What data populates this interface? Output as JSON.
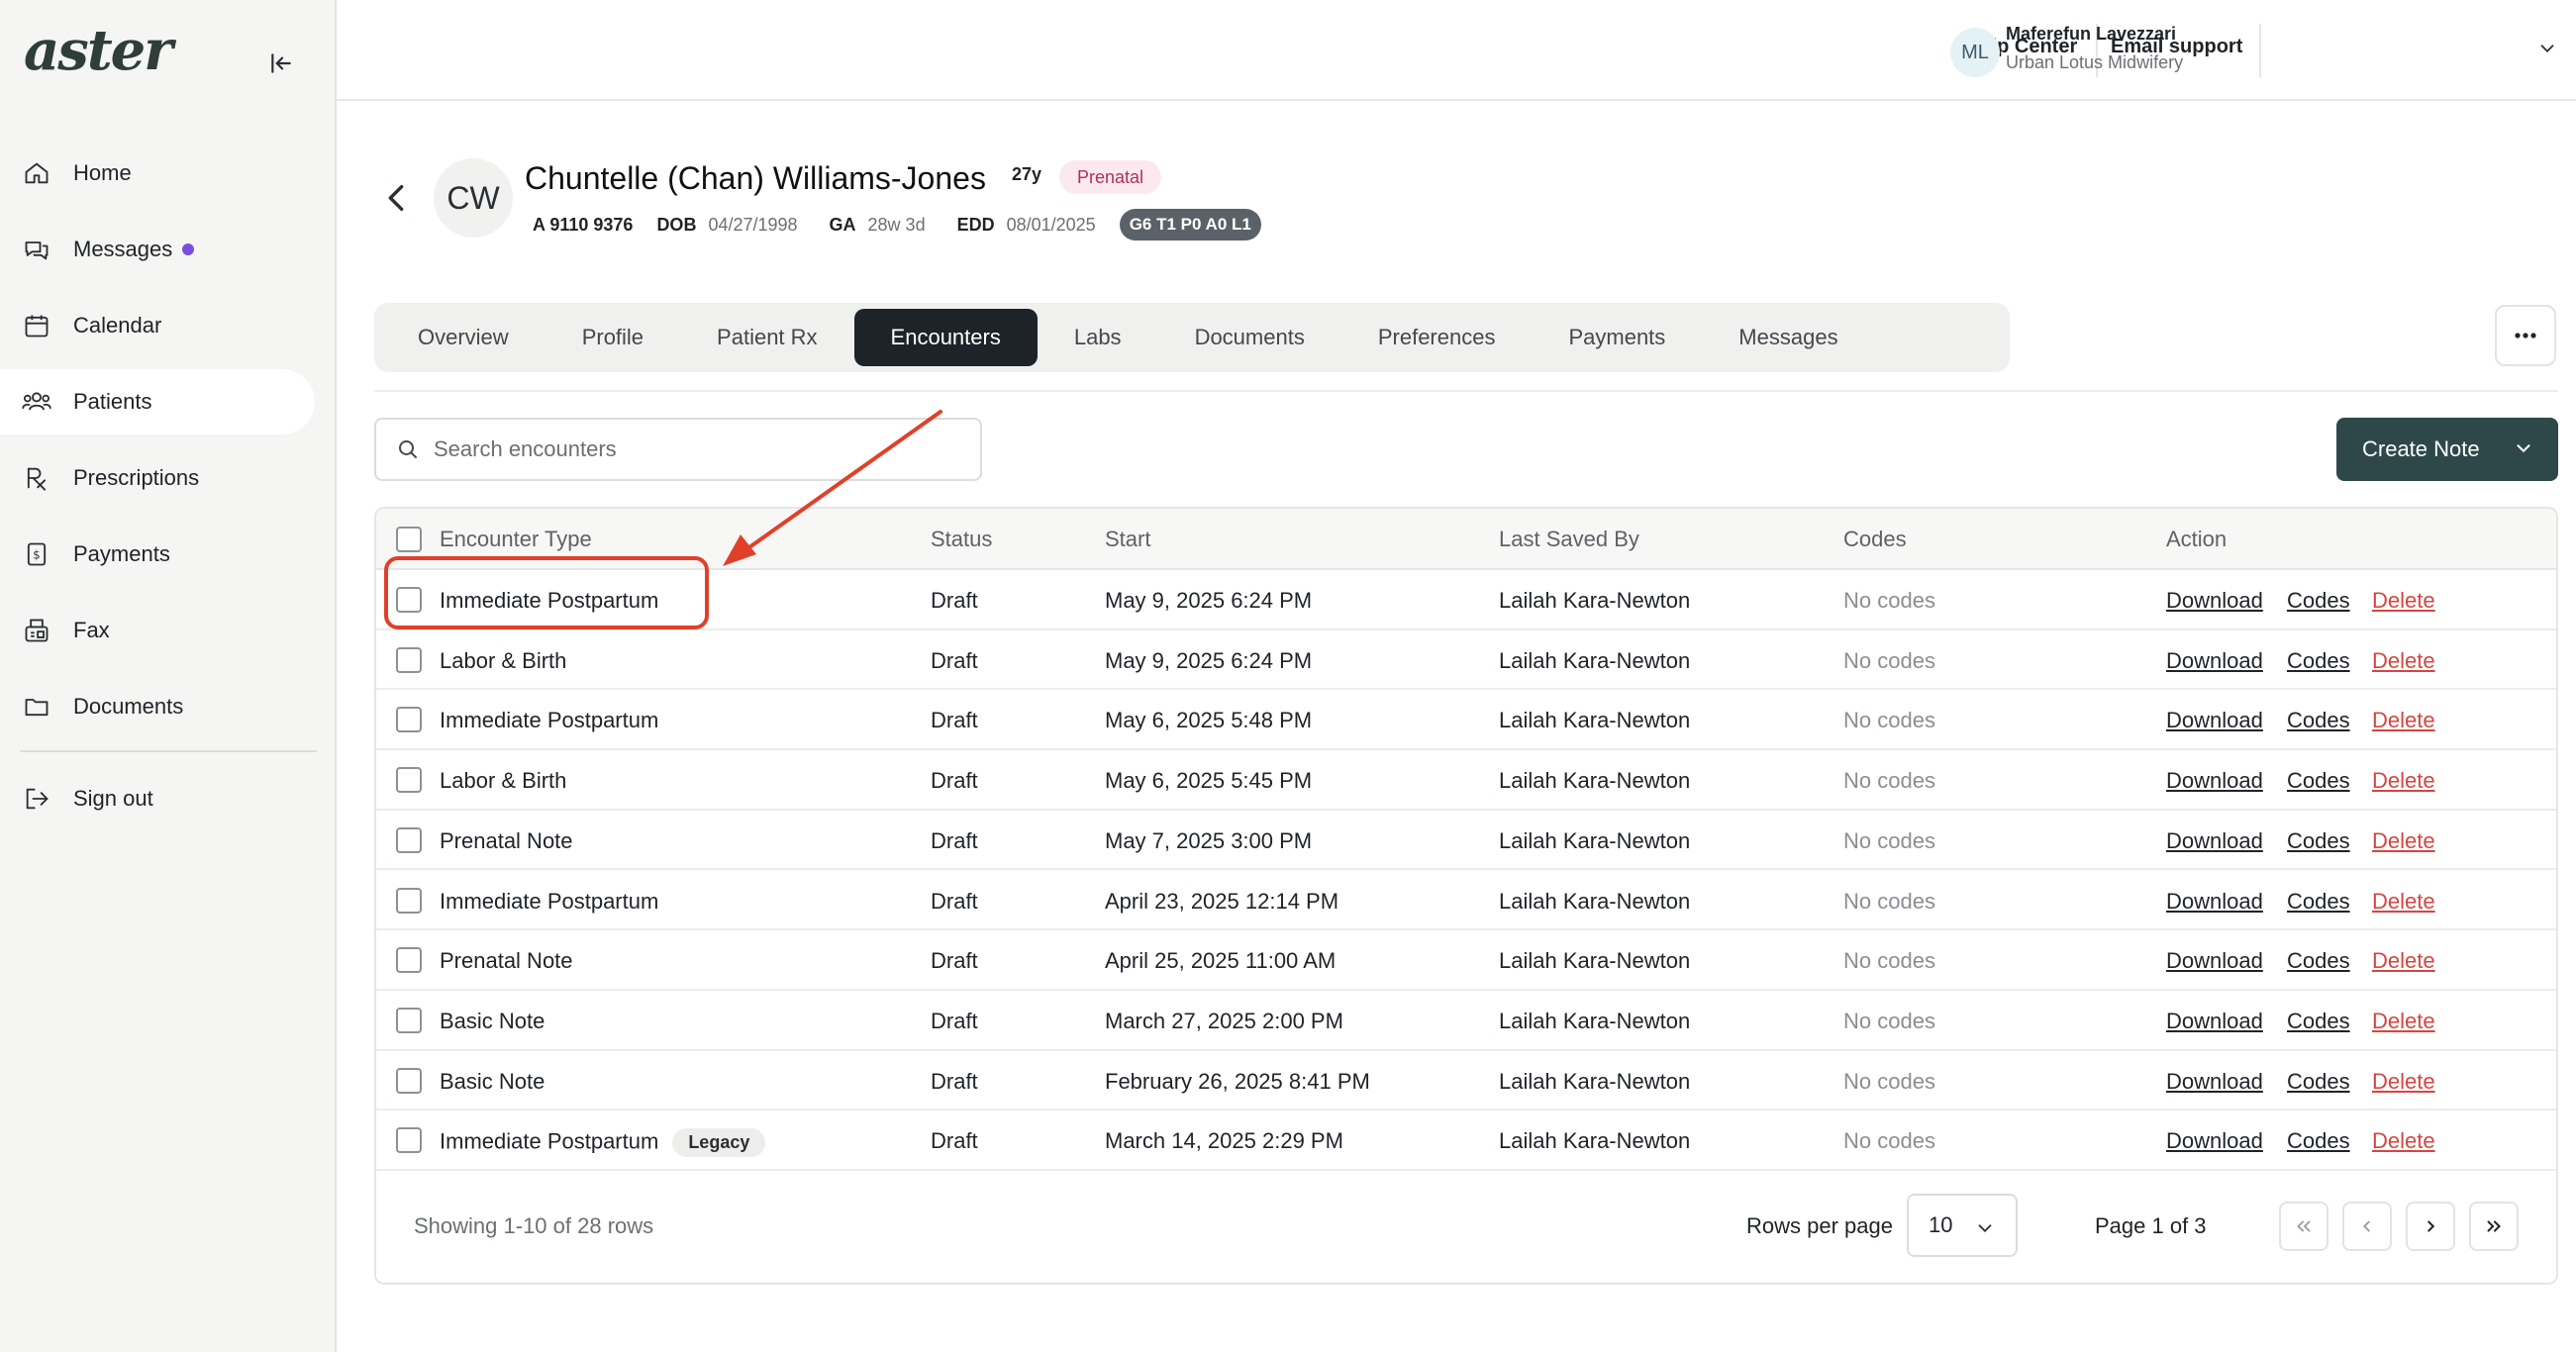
{
  "sidebar": {
    "logo": "aster",
    "items": [
      {
        "label": "Home",
        "icon": "home-icon"
      },
      {
        "label": "Messages",
        "icon": "messages-icon"
      },
      {
        "label": "Calendar",
        "icon": "calendar-icon"
      },
      {
        "label": "Patients",
        "icon": "patients-icon"
      },
      {
        "label": "Prescriptions",
        "icon": "prescription-icon"
      },
      {
        "label": "Payments",
        "icon": "payments-icon"
      },
      {
        "label": "Fax",
        "icon": "fax-icon"
      },
      {
        "label": "Documents",
        "icon": "folder-icon"
      }
    ],
    "signout_label": "Sign out"
  },
  "topbar": {
    "help_center": "Help Center",
    "email_support": "Email support",
    "user_initials": "ML",
    "user_name": "Maferefun Lavezzari",
    "user_org": "Urban Lotus Midwifery"
  },
  "patient": {
    "initials": "CW",
    "name": "Chuntelle (Chan) Williams-Jones",
    "age": "27y",
    "stage": "Prenatal",
    "id": "A 9110 9376",
    "dob_label": "DOB",
    "dob": "04/27/1998",
    "ga_label": "GA",
    "ga": "28w 3d",
    "edd_label": "EDD",
    "edd": "08/01/2025",
    "gtpal": "G6 T1 P0 A0 L1"
  },
  "tabs": [
    "Overview",
    "Profile",
    "Patient Rx",
    "Encounters",
    "Labs",
    "Documents",
    "Preferences",
    "Payments",
    "Messages"
  ],
  "active_tab": "Encounters",
  "search": {
    "placeholder": "Search encounters"
  },
  "create_note_label": "Create Note",
  "table": {
    "headers": {
      "type": "Encounter Type",
      "status": "Status",
      "start": "Start",
      "saved_by": "Last Saved By",
      "codes": "Codes",
      "action": "Action"
    },
    "action_labels": {
      "download": "Download",
      "codes": "Codes",
      "delete": "Delete"
    },
    "rows": [
      {
        "type": "Immediate Postpartum",
        "badge": "",
        "status": "Draft",
        "start": "May 9, 2025 6:24 PM",
        "saved_by": "Lailah Kara-Newton",
        "codes": "No codes"
      },
      {
        "type": "Labor & Birth",
        "badge": "",
        "status": "Draft",
        "start": "May 9, 2025 6:24 PM",
        "saved_by": "Lailah Kara-Newton",
        "codes": "No codes"
      },
      {
        "type": "Immediate Postpartum",
        "badge": "",
        "status": "Draft",
        "start": "May 6, 2025 5:48 PM",
        "saved_by": "Lailah Kara-Newton",
        "codes": "No codes"
      },
      {
        "type": "Labor & Birth",
        "badge": "",
        "status": "Draft",
        "start": "May 6, 2025 5:45 PM",
        "saved_by": "Lailah Kara-Newton",
        "codes": "No codes"
      },
      {
        "type": "Prenatal Note",
        "badge": "",
        "status": "Draft",
        "start": "May 7, 2025 3:00 PM",
        "saved_by": "Lailah Kara-Newton",
        "codes": "No codes"
      },
      {
        "type": "Immediate Postpartum",
        "badge": "",
        "status": "Draft",
        "start": "April 23, 2025 12:14 PM",
        "saved_by": "Lailah Kara-Newton",
        "codes": "No codes"
      },
      {
        "type": "Prenatal Note",
        "badge": "",
        "status": "Draft",
        "start": "April 25, 2025 11:00 AM",
        "saved_by": "Lailah Kara-Newton",
        "codes": "No codes"
      },
      {
        "type": "Basic Note",
        "badge": "",
        "status": "Draft",
        "start": "March 27, 2025 2:00 PM",
        "saved_by": "Lailah Kara-Newton",
        "codes": "No codes"
      },
      {
        "type": "Basic Note",
        "badge": "",
        "status": "Draft",
        "start": "February 26, 2025 8:41 PM",
        "saved_by": "Lailah Kara-Newton",
        "codes": "No codes"
      },
      {
        "type": "Immediate Postpartum",
        "badge": "Legacy",
        "status": "Draft",
        "start": "March 14, 2025 2:29 PM",
        "saved_by": "Lailah Kara-Newton",
        "codes": "No codes"
      }
    ]
  },
  "footer": {
    "showing": "Showing 1-10 of 28 rows",
    "rows_per_page_label": "Rows per page",
    "rows_per_page": "10",
    "page_info": "Page 1 of 3"
  },
  "colors": {
    "accent": "#2e4849",
    "active_tab": "#1d2328",
    "delete": "#d64541",
    "annotation": "#e0402a",
    "stage_badge_bg": "#fbe9ef",
    "stage_badge_text": "#b2305a"
  }
}
